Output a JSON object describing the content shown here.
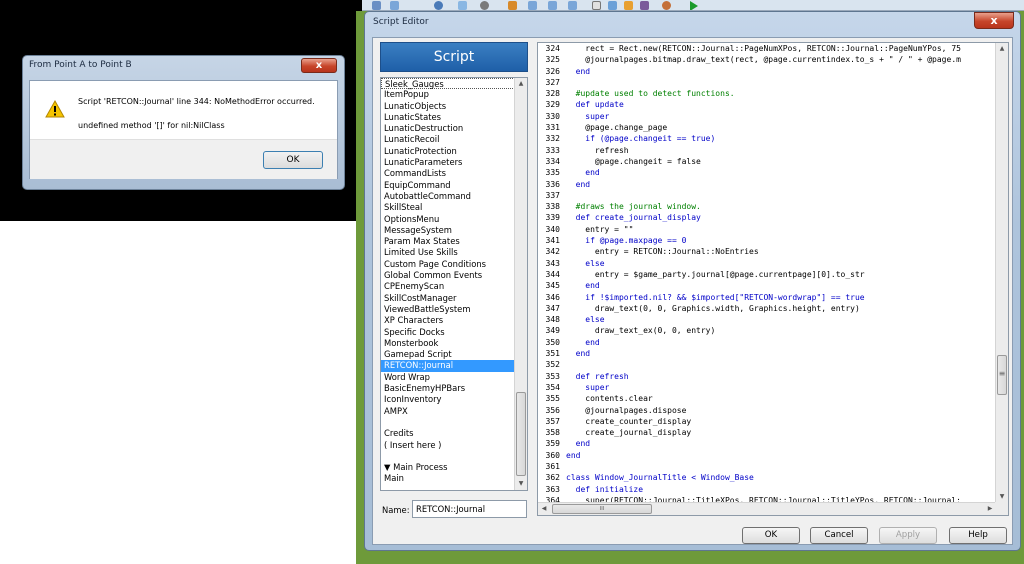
{
  "error_dialog": {
    "title": "From Point A to Point B",
    "close_label": "x",
    "message_line1": "Script 'RETCON::Journal' line 344: NoMethodError occurred.",
    "message_line2": "undefined method '[]' for nil:NilClass",
    "ok_label": "OK"
  },
  "script_editor": {
    "title": "Script Editor",
    "close_label": "x",
    "header": "Script",
    "script_list": [
      "Sleek_Gauges",
      "ItemPopup",
      "LunaticObjects",
      "LunaticStates",
      "LunaticDestruction",
      "LunaticRecoil",
      "LunaticProtection",
      "LunaticParameters",
      "CommandLists",
      "EquipCommand",
      "AutobattleCommand",
      "SkillSteal",
      "OptionsMenu",
      "MessageSystem",
      "Param Max States",
      "Limited Use Skills",
      "Custom Page Conditions",
      "Global Common Events",
      "CPEnemyScan",
      "SkillCostManager",
      "ViewedBattleSystem",
      "XP Characters",
      "Specific Docks",
      "Monsterbook",
      "Gamepad Script",
      "RETCON::Journal",
      "Word Wrap",
      "BasicEnemyHPBars",
      "IconInventory",
      "AMPX",
      "",
      "Credits",
      "( Insert here )",
      "",
      "▼ Main Process",
      "Main"
    ],
    "selected_index": 25,
    "name_label": "Name:",
    "name_value": "RETCON::Journal",
    "buttons": {
      "ok": "OK",
      "cancel": "Cancel",
      "apply": "Apply",
      "help": "Help"
    },
    "code_lines": [
      {
        "n": "324",
        "t": "    rect = Rect.new(RETCON::Journal::PageNumXPos, RETCON::Journal::PageNumYPos, 75",
        "c": ""
      },
      {
        "n": "325",
        "t": "    @journalpages.bitmap.draw_text(rect, @page.currentindex.to_s + \" / \" + @page.m",
        "c": ""
      },
      {
        "n": "326",
        "t": "  end",
        "c": "kw"
      },
      {
        "n": "327",
        "t": "",
        "c": ""
      },
      {
        "n": "328",
        "t": "  #update used to detect functions.",
        "c": "cm"
      },
      {
        "n": "329",
        "t": "  def update",
        "c": "kw"
      },
      {
        "n": "330",
        "t": "    super",
        "c": "kw"
      },
      {
        "n": "331",
        "t": "    @page.change_page",
        "c": ""
      },
      {
        "n": "332",
        "t": "    if (@page.changeit == true)",
        "c": "kw"
      },
      {
        "n": "333",
        "t": "      refresh",
        "c": ""
      },
      {
        "n": "334",
        "t": "      @page.changeit = false",
        "c": ""
      },
      {
        "n": "335",
        "t": "    end",
        "c": "kw"
      },
      {
        "n": "336",
        "t": "  end",
        "c": "kw"
      },
      {
        "n": "337",
        "t": "",
        "c": ""
      },
      {
        "n": "338",
        "t": "  #draws the journal window.",
        "c": "cm"
      },
      {
        "n": "339",
        "t": "  def create_journal_display",
        "c": "kw"
      },
      {
        "n": "340",
        "t": "    entry = \"\"",
        "c": ""
      },
      {
        "n": "341",
        "t": "    if @page.maxpage == 0",
        "c": "kw"
      },
      {
        "n": "342",
        "t": "      entry = RETCON::Journal::NoEntries",
        "c": ""
      },
      {
        "n": "343",
        "t": "    else",
        "c": "kw"
      },
      {
        "n": "344",
        "t": "      entry = $game_party.journal[@page.currentpage][0].to_str",
        "c": ""
      },
      {
        "n": "345",
        "t": "    end",
        "c": "kw"
      },
      {
        "n": "346",
        "t": "    if !$imported.nil? && $imported[\"RETCON-wordwrap\"] == true",
        "c": "kw"
      },
      {
        "n": "347",
        "t": "      draw_text(0, 0, Graphics.width, Graphics.height, entry)",
        "c": ""
      },
      {
        "n": "348",
        "t": "    else",
        "c": "kw"
      },
      {
        "n": "349",
        "t": "      draw_text_ex(0, 0, entry)",
        "c": ""
      },
      {
        "n": "350",
        "t": "    end",
        "c": "kw"
      },
      {
        "n": "351",
        "t": "  end",
        "c": "kw"
      },
      {
        "n": "352",
        "t": "",
        "c": ""
      },
      {
        "n": "353",
        "t": "  def refresh",
        "c": "kw"
      },
      {
        "n": "354",
        "t": "    super",
        "c": "kw"
      },
      {
        "n": "355",
        "t": "    contents.clear",
        "c": ""
      },
      {
        "n": "356",
        "t": "    @journalpages.dispose",
        "c": ""
      },
      {
        "n": "357",
        "t": "    create_counter_display",
        "c": ""
      },
      {
        "n": "358",
        "t": "    create_journal_display",
        "c": ""
      },
      {
        "n": "359",
        "t": "  end",
        "c": "kw"
      },
      {
        "n": "360",
        "t": "end",
        "c": "kw"
      },
      {
        "n": "361",
        "t": "",
        "c": ""
      },
      {
        "n": "362",
        "t": "class Window_JournalTitle < Window_Base",
        "c": "kw"
      },
      {
        "n": "363",
        "t": "  def initialize",
        "c": "kw"
      },
      {
        "n": "364",
        "t": "    super(RETCON::Journal::TitleXPos, RETCON::Journal::TitleYPos, RETCON::Journal:",
        "c": ""
      }
    ],
    "scroll_h_glyph": "III",
    "scroll_v_glyph": "≡"
  },
  "colors": {
    "selection": "#3399ff",
    "comment": "#008000",
    "keyword": "#0000c8",
    "string": "#8b008b",
    "header_blue": "#1f5fa8"
  }
}
